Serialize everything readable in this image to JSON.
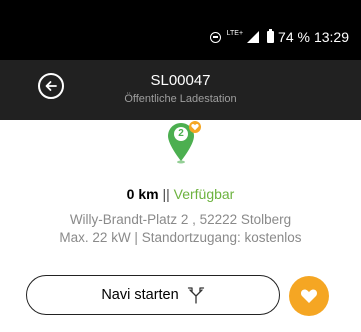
{
  "statusbar": {
    "network": "LTE+",
    "battery": "74 %",
    "time": "13:29",
    "icons": [
      "do-not-disturb-icon",
      "signal-icon",
      "battery-icon"
    ]
  },
  "appbar": {
    "title": "SL00047",
    "subtitle": "Öffentliche Ladestation",
    "back_icon": "back-arrow-icon"
  },
  "station": {
    "pin_count": "2",
    "distance": "0 km",
    "separator": "||",
    "availability": "Verfügbar",
    "address": "Willy-Brandt-Platz 2 , 52222 Stolberg",
    "power": "Max. 22 kW | Standortzugang: kostenlos"
  },
  "actions": {
    "navi_label": "Navi starten",
    "navi_icon": "route-icon",
    "favorite_icon": "heart-icon"
  },
  "colors": {
    "statusbar_bg": "#000000",
    "appbar_bg": "#212121",
    "available_green": "#6db33f",
    "pin_green": "#4caf50",
    "accent_orange": "#f5a623"
  }
}
